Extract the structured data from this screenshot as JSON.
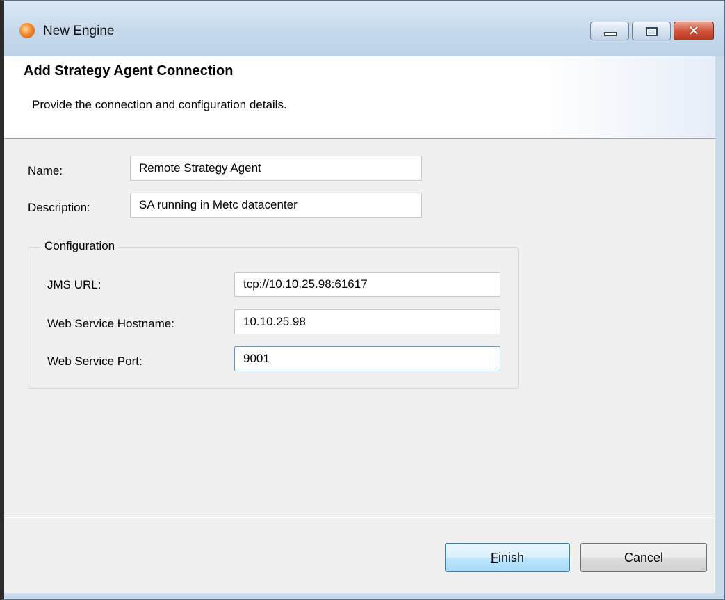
{
  "window": {
    "title": "New Engine",
    "controls": {
      "minimize": "minimize",
      "maximize": "maximize",
      "close": "✕"
    }
  },
  "banner": {
    "title": "Add Strategy Agent Connection",
    "description": "Provide the connection and configuration details."
  },
  "form": {
    "name": {
      "label": "Name:",
      "value": "Remote Strategy Agent"
    },
    "description": {
      "label": "Description:",
      "value": "SA running in Metc datacenter"
    }
  },
  "configuration": {
    "title": "Configuration",
    "jms_url": {
      "label": "JMS URL:",
      "value": "tcp://10.10.25.98:61617"
    },
    "ws_hostname": {
      "label": "Web Service Hostname:",
      "value": "10.10.25.98"
    },
    "ws_port": {
      "label": "Web Service Port:",
      "value": "9001"
    }
  },
  "buttons": {
    "finish": {
      "mnemonic": "F",
      "rest": "inish"
    },
    "cancel": "Cancel"
  },
  "icons": {
    "app": "engine-app-icon",
    "minimize": "minimize-icon",
    "maximize": "maximize-icon",
    "close": "close-icon"
  }
}
